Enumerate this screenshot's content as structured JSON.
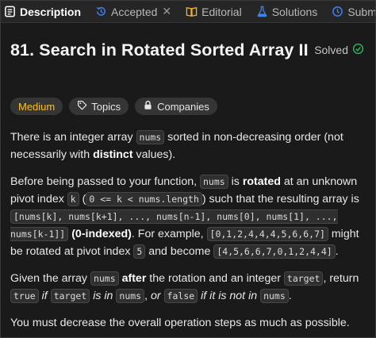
{
  "tabs": [
    {
      "label": "Description",
      "icon": "description-icon",
      "active": true
    },
    {
      "label": "Accepted",
      "icon": "history-icon",
      "closable": true
    },
    {
      "label": "Editorial",
      "icon": "book-icon"
    },
    {
      "label": "Solutions",
      "icon": "flask-icon"
    },
    {
      "label": "Submissions",
      "icon": "clock-icon"
    }
  ],
  "problem": {
    "title": "81. Search in Rotated Sorted Array II",
    "status": "Solved",
    "difficulty": "Medium",
    "topics_label": "Topics",
    "companies_label": "Companies"
  },
  "description": {
    "p1": {
      "t1": "There is an integer array ",
      "c1": "nums",
      "t2": " sorted in non-decreasing order (not necessarily with ",
      "b1": "distinct",
      "t3": " values)."
    },
    "p2": {
      "t1": "Before being passed to your function, ",
      "c1": "nums",
      "t2": " is ",
      "b1": "rotated",
      "t3": " at an unknown pivot index ",
      "c2": "k",
      "t4": " (",
      "c3": "0 <= k < nums.length",
      "t5": ") such that the resulting array is ",
      "c4": "[nums[k], nums[k+1], ..., nums[n-1], nums[0], nums[1], ..., nums[k-1]]",
      "t6": " ",
      "b2": "(0-indexed)",
      "t7": ". For example, ",
      "c5": "[0,1,2,4,4,4,5,6,6,7]",
      "t8": " might be rotated at pivot index ",
      "c6": "5",
      "t9": " and become ",
      "c7": "[4,5,6,6,7,0,1,2,4,4]",
      "t10": "."
    },
    "p3": {
      "t1": "Given the array ",
      "c1": "nums",
      "t2": " ",
      "b1": "after",
      "t3": " the rotation and an integer ",
      "c2": "target",
      "t4": ", return ",
      "c3": "true",
      "t5": " ",
      "i1": "if",
      "t6": " ",
      "c4": "target",
      "t7": " ",
      "i2": "is in",
      "t8": " ",
      "c5": "nums",
      "t9": ", ",
      "i3": "or",
      "t10": " ",
      "c6": "false",
      "t11": " ",
      "i4": "if it is not in",
      "t12": " ",
      "c7": "nums",
      "t13": "."
    },
    "p4": "You must decrease the overall operation steps as much as possible."
  },
  "colors": {
    "background": "#1a1a1a",
    "medium": "#ffc01e",
    "solved_check": "#2db55d"
  }
}
